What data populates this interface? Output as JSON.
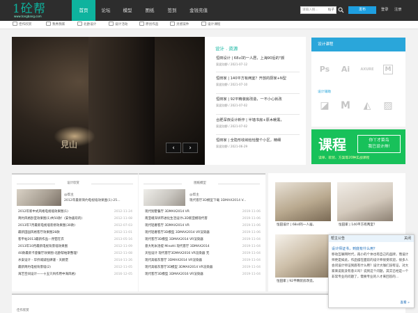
{
  "header": {
    "logo_text": "1砼帮",
    "logo_domain": "www.tongbang.com",
    "nav": [
      "首页",
      "论坛",
      "模型",
      "图纸",
      "签到",
      "金钱充值"
    ],
    "search_placeholder": "请输入搜...",
    "search_type": "帖子",
    "publish": "发布",
    "login": "登录",
    "register": "注册"
  },
  "subnav": [
    "佳作欣赏",
    "我秀我家",
    "北欧设计",
    "设计活动",
    "原创作品",
    "灵感案件",
    "设计课程"
  ],
  "news": {
    "title": "设计 . 资源",
    "items": [
      {
        "title": "恒田设计 | 68㎡的一人居，上海90后的\"颜",
        "meta": "家居别野 / 2021-07-12"
      },
      {
        "title": "恒田家 | 140平方有两室？开放的厨家+N型",
        "meta": "家居别野 / 2021-07-10"
      },
      {
        "title": "恒田家 | 92平精装房改造，一不小心就改",
        "meta": "家居别野 / 2021-07-02"
      },
      {
        "title": "合肥深夜设计新作 | 半墙书房+原木暖黑，",
        "meta": "家居别野 / 2021-07-02"
      },
      {
        "title": "恒田家 | 全隐形收纳恰恰整个小区，精细",
        "meta": "家居别野 / 2021-06-29"
      }
    ]
  },
  "side_panel": {
    "header": "设计课程",
    "tools1": [
      "Ps",
      "Ai",
      "AXURE",
      "M"
    ],
    "tools2_label": "设计辅助",
    "tools2": [
      "◪",
      "M",
      "◭",
      "▨"
    ]
  },
  "ad": {
    "big": "课程",
    "right1": "你丫才菜鸟",
    "right2": "我已设计帅!",
    "foot": "读单、软装、方案等20种实战课程"
  },
  "card1": {
    "tag": "设计欣赏",
    "thumb_author": "@帮主",
    "thumb_title": "2012年最新简约电视墙效果图(1)-25...",
    "rows": [
      {
        "title": "2012年新中式风格电视墙效果图(1)",
        "date": "2012-11-24"
      },
      {
        "title": "简约风格卧室效果图(1)共50款！(安你喜欢的)",
        "date": "2012-11-08"
      },
      {
        "title": "2013年7月最新电视墙装修效果图(30款)",
        "date": "2012-07-03"
      },
      {
        "title": "最新田园风格客厅效果图28款",
        "date": "2012-11-01"
      },
      {
        "title": "客平帖2013最新作品---琵琶在衣",
        "date": "2013-05-16"
      },
      {
        "title": "2013年10月最新电视背景墙效果图",
        "date": "2012-11-09"
      },
      {
        "title": "40款最新卡座餐厅效果图-北欧帮帕斯整理！",
        "date": "2012-11-08"
      },
      {
        "title": "水安设计 - 华侨城诚恒肆谨 - 天鹅堡",
        "date": "2014-11-26"
      },
      {
        "title": "最新简约电视背景墙(2)",
        "date": "2012-11-05"
      },
      {
        "title": "海艺空间设计——十五只夙作用中海风格)",
        "date": "2016-12-05"
      }
    ]
  },
  "card2": {
    "tag": "图纸模型",
    "thumb_author": "@帮主",
    "thumb_title": "现代客厅3D模型下载 3DMAX2014 V...",
    "rows": [
      {
        "title": "现代别墅餐厅 3DMAX2014 VR",
        "date": "2019-11-06"
      },
      {
        "title": "南亚峨深圳市进化生活设计L3D新亚模现代客",
        "date": "2019-11-06"
      },
      {
        "title": "现代轻奢客厅 3DMAX2014 VR",
        "date": "2019-11-06"
      },
      {
        "title": "现代轻奢客厅3D模型 3DMAX2014 VR渲染器",
        "date": "2019-11-06"
      },
      {
        "title": "现代客厅3D模型 3DMAX2014 VR渲染器",
        "date": "2019-11-04"
      },
      {
        "title": "意大利米洛提 Minotti 现代客厅 3DMAX2014",
        "date": "2019-11-04"
      },
      {
        "title": "天恒设计 现代客厅3DMAX2016 VR渲染器 无",
        "date": "2019-11-04"
      },
      {
        "title": "现代高级灰客厅 3DMAX2014 VR渲染器",
        "date": "2019-11-04"
      },
      {
        "title": "现代高级灰客厅3D模型 3DMAX2014 VR渲染器",
        "date": "2019-11-04"
      },
      {
        "title": "现代客厅3D模型 3DMAX2016 VR渲染器",
        "date": "2019-11-04"
      }
    ]
  },
  "gallery": [
    {
      "caption": "恒田设计 | 68㎡的一人居，"
    },
    {
      "caption": "恒田家 | 140平方有两室？"
    },
    {
      "caption": "恒田家 | 92平精装房改造，"
    }
  ],
  "popup": {
    "title": "帮主公告",
    "close": "关闭",
    "question": "设计师证书，到底有什么用？",
    "body": "移动互联网时代，再小的个体也有自己的品牌，而设计师更是如此，作品摆在面前的设计师很受欢迎，很多人会问设计师证到底有什么用？设计大咖们没有证，对大家来说就没有意义吗？说到这个问题，其实已经是一个非常专业的问题了，需要专业的人才来回答的...",
    "more": "查看 »"
  },
  "bottom_tag": "佳作欣赏"
}
